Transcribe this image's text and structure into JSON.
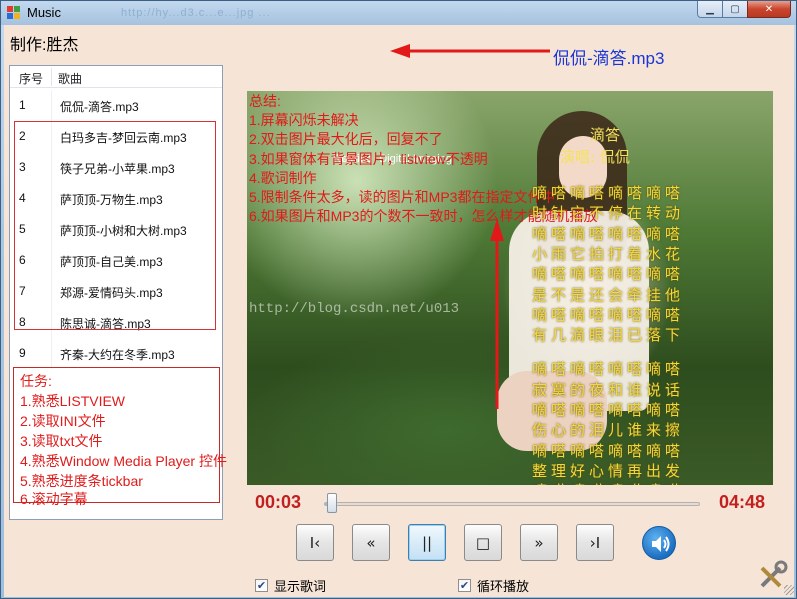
{
  "window": {
    "title": "Music",
    "ghost_title": "http://hy...d3.c...e...jpg ..."
  },
  "header": {
    "author": "制作:胜杰",
    "now_playing": "侃侃-滴答.mp3"
  },
  "playlist": {
    "columns": [
      "序号",
      "歌曲"
    ],
    "rows": [
      {
        "no": "1",
        "song": "侃侃-滴答.mp3"
      },
      {
        "no": "2",
        "song": "白玛多吉-梦回云南.mp3"
      },
      {
        "no": "3",
        "song": "筷子兄弟-小苹果.mp3"
      },
      {
        "no": "4",
        "song": "萨顶顶-万物生.mp3"
      },
      {
        "no": "5",
        "song": "萨顶顶-小树和大树.mp3"
      },
      {
        "no": "6",
        "song": "萨顶顶-自己美.mp3"
      },
      {
        "no": "7",
        "song": "郑源-爱情码头.mp3"
      },
      {
        "no": "8",
        "song": "陈思诚-滴答.mp3"
      },
      {
        "no": "9",
        "song": "齐秦-大约在冬季.mp3"
      }
    ]
  },
  "tasks": {
    "heading": "任务:",
    "items": [
      "1.熟悉LISTVIEW",
      "2.读取INI文件",
      "3.读取txt文件",
      "4.熟悉Window Media Player 控件",
      "5.熟悉进度条tickbar",
      "6.滚动字幕"
    ]
  },
  "summary": {
    "heading": "总结:",
    "items": [
      "1.屏幕闪烁未解决",
      "2.双击图片最大化后，回复不了",
      "3.如果窗体有背景图片，listview不透明",
      "4.歌词制作",
      "5.限制条件太多，读的图片和MP3都在指定文件中",
      "6.如果图片和MP3的个数不一致时，怎么样才能随机播放"
    ]
  },
  "picture": {
    "overlay_brand": "Rejoice",
    "overlay_sub": "Digital Imaging",
    "watermark": "http://blog.csdn.net/u013"
  },
  "lyrics": {
    "title": "滴答",
    "singer": "演唱: 侃侃",
    "lines": [
      "嘀嗒嘀嗒嘀嗒嘀嗒",
      "时针它不停在转动",
      "嘀嗒嘀嗒嘀嗒嘀嗒",
      "小雨它拍打着水花",
      "嘀嗒嘀嗒嘀嗒嘀嗒",
      "是不是还会牵挂他",
      "嘀嗒嘀嗒嘀嗒嘀嗒",
      "有几滴眼泪已落下",
      "嘀嗒嘀嗒嘀嗒嘀嗒",
      "寂寞的夜和谁说话",
      "嘀嗒嘀嗒嘀嗒嘀嗒",
      "伤心的泪儿谁来擦",
      "嘀嗒嘀嗒嘀嗒嘀嗒",
      "整理好心情再出发",
      "嘀嗒嘀嗒嘀嗒嘀嗒"
    ]
  },
  "player": {
    "current_time": "00:03",
    "total_time": "04:48",
    "progress": 0.01,
    "buttons": {
      "first": "I‹",
      "rewind": "«",
      "pause": "||",
      "stop": "□",
      "forward": "»",
      "last": "›I"
    },
    "show_lyrics_label": "显示歌词",
    "show_lyrics_checked": true,
    "loop_label": "循环播放",
    "loop_checked": true
  },
  "colors": {
    "annotation_red": "#e21919",
    "now_playing_blue": "#1a35d4",
    "time_red": "#c41f1f",
    "lyrics_yellow": "#f3d83c"
  }
}
